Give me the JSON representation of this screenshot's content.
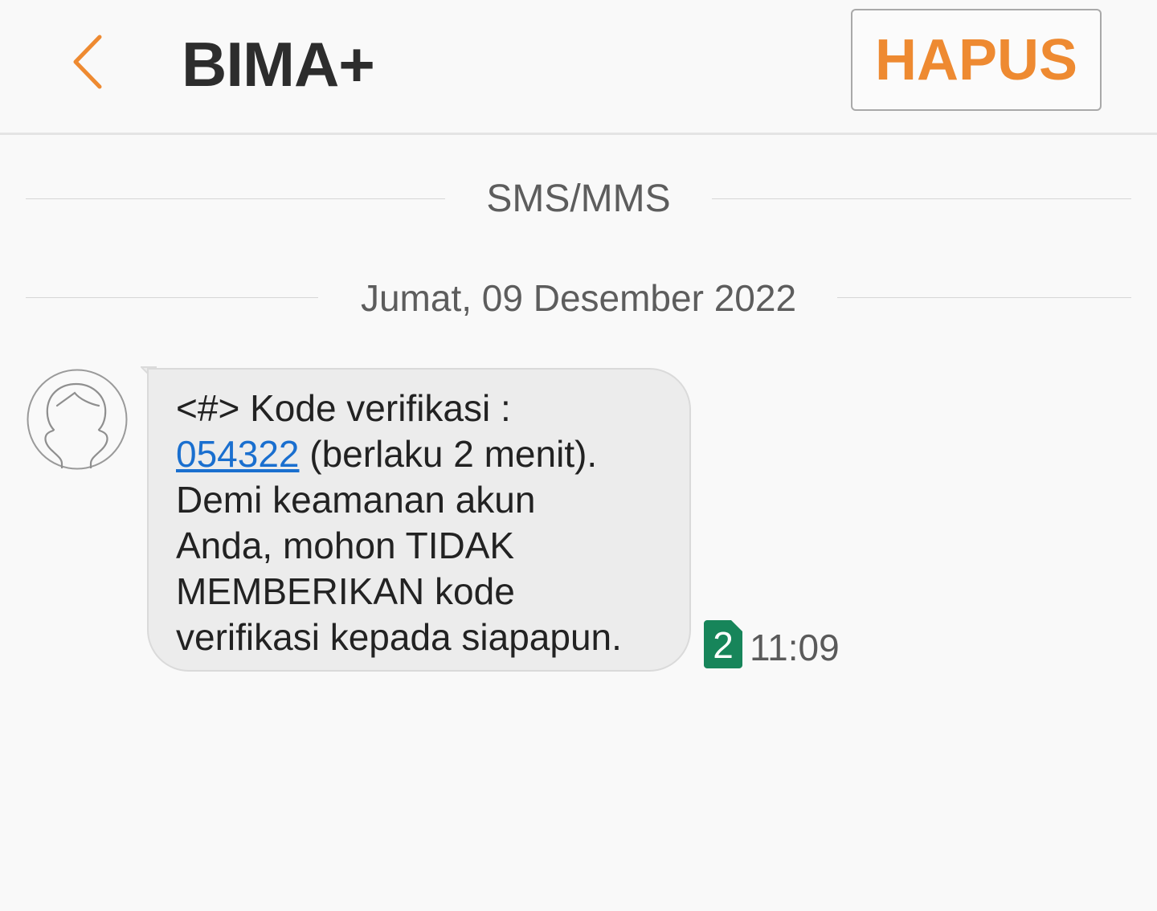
{
  "header": {
    "title": "BIMA+",
    "delete_label": "HAPUS"
  },
  "dividers": {
    "channel": "SMS/MMS",
    "date": "Jumat, 09 Desember 2022"
  },
  "message": {
    "prefix": "<#> Kode verifikasi :\n",
    "code": "054322",
    "suffix": " (berlaku 2 menit).\nDemi keamanan akun\nAnda, mohon TIDAK\nMEMBERIKAN kode\nverifikasi kepada siapapun.",
    "sim_slot": "2",
    "time": "11:09"
  },
  "colors": {
    "accent": "#ee8a31",
    "link": "#1a6fcf",
    "sim_badge": "#17855a"
  },
  "icons": {
    "back": "chevron-left-icon",
    "avatar": "person-icon",
    "sim": "sim-card-icon"
  }
}
